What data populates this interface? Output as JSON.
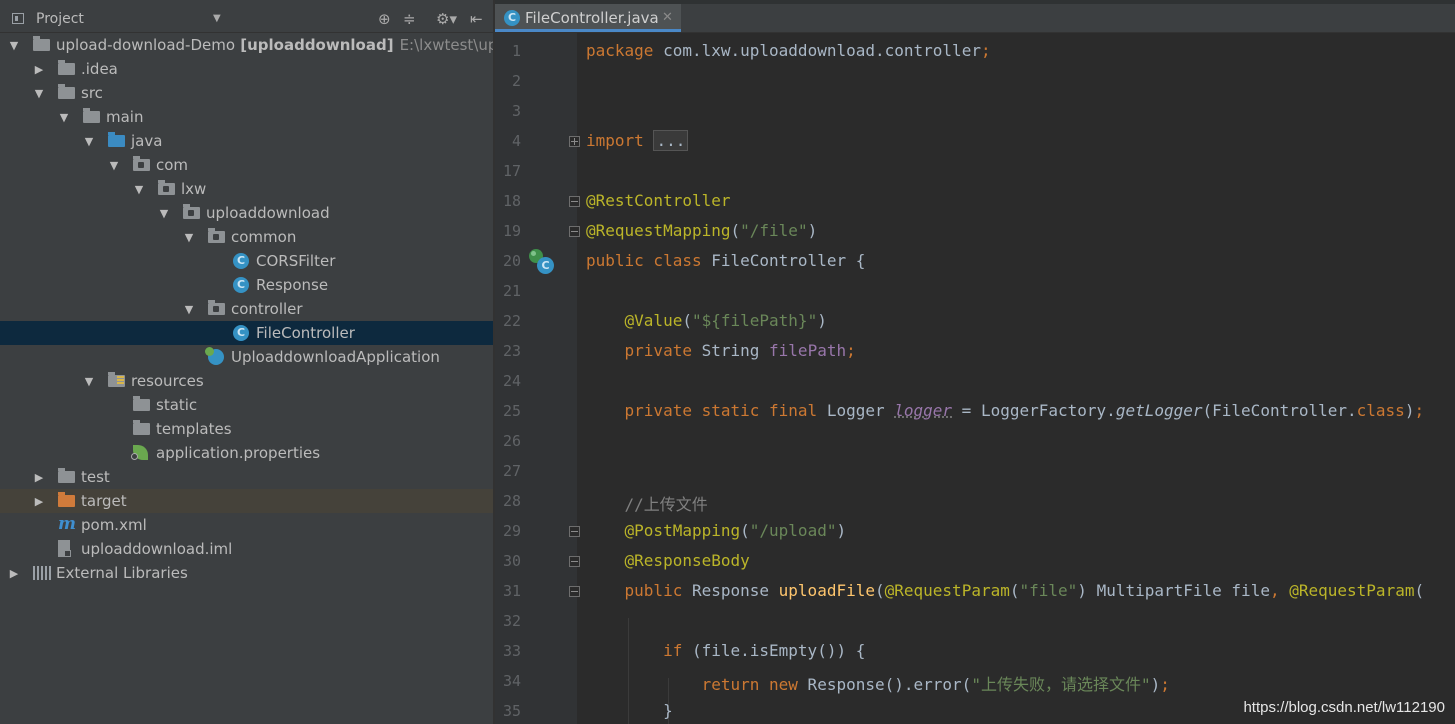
{
  "project_panel": {
    "title": "Project",
    "tree": [
      {
        "label": "upload-download-Demo",
        "module": "[uploaddownload]",
        "path": "E:\\lxwtest\\uplo",
        "icon": "module-folder-icon",
        "arrow": "▼"
      },
      {
        "label": ".idea",
        "icon": "folder-icon",
        "arrow": "▶"
      },
      {
        "label": "src",
        "icon": "folder-icon",
        "arrow": "▼"
      },
      {
        "label": "main",
        "icon": "folder-icon",
        "arrow": "▼"
      },
      {
        "label": "java",
        "icon": "source-folder-icon",
        "arrow": "▼"
      },
      {
        "label": "com",
        "icon": "package-icon",
        "arrow": "▼"
      },
      {
        "label": "lxw",
        "icon": "package-icon",
        "arrow": "▼"
      },
      {
        "label": "uploaddownload",
        "icon": "package-icon",
        "arrow": "▼"
      },
      {
        "label": "common",
        "icon": "package-icon",
        "arrow": "▼"
      },
      {
        "label": "CORSFilter",
        "icon": "class-icon"
      },
      {
        "label": "Response",
        "icon": "class-icon"
      },
      {
        "label": "controller",
        "icon": "package-icon",
        "arrow": "▼"
      },
      {
        "label": "FileController",
        "icon": "class-icon",
        "selected": true
      },
      {
        "label": "UploaddownloadApplication",
        "icon": "spring-boot-app-icon"
      },
      {
        "label": "resources",
        "icon": "resources-folder-icon",
        "arrow": "▼"
      },
      {
        "label": "static",
        "icon": "folder-icon"
      },
      {
        "label": "templates",
        "icon": "folder-icon"
      },
      {
        "label": "application.properties",
        "icon": "spring-properties-icon"
      },
      {
        "label": "test",
        "icon": "folder-icon",
        "arrow": "▶"
      },
      {
        "label": "target",
        "icon": "excluded-folder-icon",
        "arrow": "▶"
      },
      {
        "label": "pom.xml",
        "icon": "maven-icon"
      },
      {
        "label": "uploaddownload.iml",
        "icon": "iml-file-icon"
      },
      {
        "label": "External Libraries",
        "icon": "libraries-icon",
        "arrow": "▶"
      }
    ]
  },
  "editor": {
    "tab_label": "FileController.java",
    "lines": [
      {
        "n": "1",
        "html": "<span class=\"kw\">package</span> com.lxw.uploaddownload.controller<span class=\"kw\">;</span>"
      },
      {
        "n": "2",
        "html": ""
      },
      {
        "n": "3",
        "html": ""
      },
      {
        "n": "4",
        "html": "<span class=\"kw\">import</span> <span class=\"import-fold\">...</span>"
      },
      {
        "n": "17",
        "html": ""
      },
      {
        "n": "18",
        "html": "<span class=\"an\">@RestController</span>"
      },
      {
        "n": "19",
        "html": "<span class=\"an\">@RequestMapping</span>(<span class=\"st\">\"/file\"</span>)"
      },
      {
        "n": "20",
        "html": "<span class=\"kw\">public class</span> FileController {"
      },
      {
        "n": "21",
        "html": ""
      },
      {
        "n": "22",
        "html": "    <span class=\"an\">@Value</span>(<span class=\"st\">\"${filePath}\"</span>)"
      },
      {
        "n": "23",
        "html": "    <span class=\"kw\">private</span> String <span class=\"fd\">filePath</span><span class=\"kw\">;</span>"
      },
      {
        "n": "24",
        "html": ""
      },
      {
        "n": "25",
        "html": "    <span class=\"kw\">private static final</span> Logger <span class=\"sfield\">logger</span> = LoggerFactory.<span class=\"it\">getLogger</span>(FileController.<span class=\"kw\">class</span>)<span class=\"kw\">;</span>"
      },
      {
        "n": "26",
        "html": ""
      },
      {
        "n": "27",
        "html": ""
      },
      {
        "n": "28",
        "html": "    <span class=\"cm\">//上传文件</span>"
      },
      {
        "n": "29",
        "html": "    <span class=\"an\">@PostMapping</span>(<span class=\"st\">\"/upload\"</span>)"
      },
      {
        "n": "30",
        "html": "    <span class=\"an\">@ResponseBody</span>"
      },
      {
        "n": "31",
        "html": "    <span class=\"kw\">public</span> Response <span class=\"fn\">uploadFile</span>(<span class=\"an\">@RequestParam</span>(<span class=\"st\">\"file\"</span>) MultipartFile file<span class=\"kw\">,</span> <span class=\"an\">@RequestParam</span>("
      },
      {
        "n": "32",
        "html": ""
      },
      {
        "n": "33",
        "html": "        <span class=\"kw\">if</span> (file.isEmpty()) {"
      },
      {
        "n": "34",
        "html": "            <span class=\"kw\">return new</span> Response().error(<span class=\"st\">\"上传失败，请选择文件\"</span>)<span class=\"kw\">;</span>"
      },
      {
        "n": "35",
        "html": "        }"
      }
    ]
  },
  "watermark": "https://blog.csdn.net/lw112190",
  "colors": {
    "accent": "#4a88c7",
    "keyword": "#cc7832",
    "annotation": "#bbb529",
    "string": "#6a8759"
  }
}
